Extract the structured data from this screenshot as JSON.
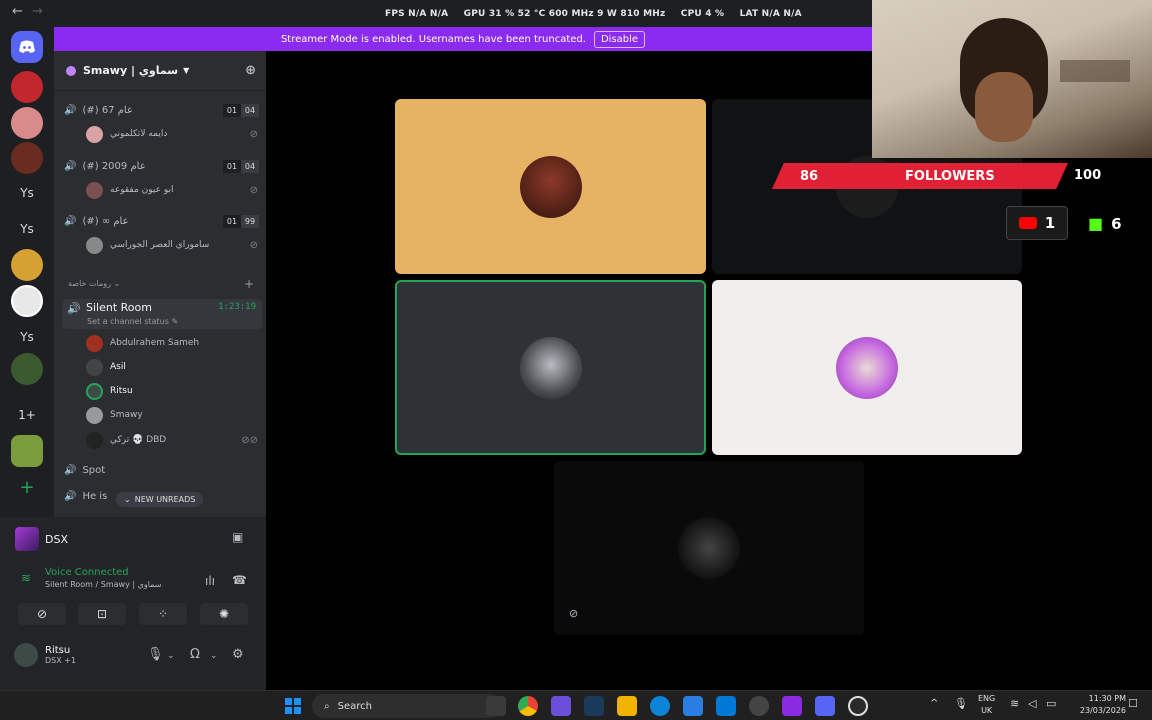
{
  "topbar": {
    "perf": {
      "fps": "FPS N/A N/A",
      "gpu": "GPU 31 % 52 °C 600 MHz 9 W 810 MHz",
      "cpu": "CPU 4 %",
      "lat": "LAT N/A N/A"
    },
    "title": "Smawy | سماوي"
  },
  "banner": {
    "text": "Streamer Mode is enabled. Usernames have been truncated.",
    "button": "Disable"
  },
  "rail": {
    "servers": [
      "Ys",
      "Ys",
      "Ys",
      "1+"
    ]
  },
  "guild": {
    "name": "Smawy | سماوي"
  },
  "channels": [
    {
      "name": "(#) 67 عام",
      "count_a": "01",
      "count_b": "04",
      "member": "دايمه لاتكلموني"
    },
    {
      "name": "(#) 2009 عام",
      "count_a": "01",
      "count_b": "04",
      "member": "ابو عيون مفقوعه"
    },
    {
      "name": "(#) ∞ عام",
      "count_a": "01",
      "count_b": "99",
      "member": "ساموراي العصر الجوراسي"
    }
  ],
  "category": "رومات خاصة",
  "silent_room": {
    "name": "Silent Room",
    "time": "1:23:19",
    "status": "Set a channel status",
    "members": [
      "Abdulrahem Sameh",
      "Asil",
      "Ritsu",
      "Smawy",
      "تركي 💀 DBD"
    ]
  },
  "other_channels": [
    "Spot",
    "He is"
  ],
  "new_unreads": "NEW UNREADS",
  "panel": {
    "server_name": "DSX",
    "voice_status": "Voice Connected",
    "voice_channel": "Silent Room / Smawy | سماوي",
    "username": "Ritsu",
    "user_sub": "DSX +1"
  },
  "overlay": {
    "followers_current": "86",
    "followers_label": "FOLLOWERS",
    "followers_goal": "100",
    "youtube_count": "1",
    "kick_count": "6"
  },
  "taskbar": {
    "search": "Search",
    "lang_1": "ENG",
    "lang_2": "UK",
    "time": "11:30 PM",
    "date": "23/03/2026"
  },
  "colors": {
    "banner": "#8b2bf0",
    "voice_green": "#23a559",
    "followers_red": "#e02035"
  }
}
